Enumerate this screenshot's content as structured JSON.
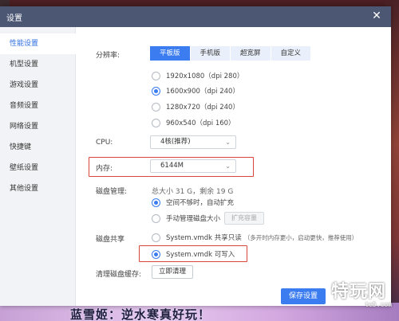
{
  "window": {
    "title": "设置"
  },
  "sidebar": {
    "items": [
      {
        "label": "性能设置"
      },
      {
        "label": "机型设置"
      },
      {
        "label": "游戏设置"
      },
      {
        "label": "音频设置"
      },
      {
        "label": "网络设置"
      },
      {
        "label": "快捷键"
      },
      {
        "label": "壁纸设置"
      },
      {
        "label": "其他设置"
      }
    ]
  },
  "resolution": {
    "label": "分辨率:",
    "tabs": [
      "平板版",
      "手机版",
      "超宽屏",
      "自定义"
    ],
    "options": [
      {
        "label": "1920x1080（dpi 280）",
        "checked": false
      },
      {
        "label": "1600x900（dpi 240）",
        "checked": true
      },
      {
        "label": "1280x720（dpi 240）",
        "checked": false
      },
      {
        "label": "960x540（dpi 160）",
        "checked": false
      }
    ]
  },
  "cpu": {
    "label": "CPU:",
    "value": "4核(推荐)"
  },
  "memory": {
    "label": "内存:",
    "value": "6144M"
  },
  "disk": {
    "label": "磁盘管理:",
    "summary": "总大小 31 G，剩余 19 G",
    "options": [
      {
        "label": "空间不够时，自动扩充",
        "checked": true
      },
      {
        "label": "手动管理磁盘大小",
        "checked": false
      }
    ],
    "expand_button": "扩充容量"
  },
  "disk_share": {
    "label": "磁盘共享",
    "options": [
      {
        "label": "System.vmdk 共享只读",
        "note": "（多开时内存更小，启动更快，推荐使用）",
        "checked": false
      },
      {
        "label": "System.vmdk 可写入",
        "checked": true
      }
    ]
  },
  "cache": {
    "label": "清理磁盘缓存:",
    "button": "立即清理"
  },
  "save_button": "保存设置",
  "background": {
    "bottom_text": "蓝雪姬：逆水寒真好玩！"
  },
  "watermark": {
    "main": "特玩网",
    "sub": "te5.com"
  },
  "colors": {
    "accent": "#3b7cf0",
    "titlebar": "#4b5773",
    "highlight": "#d9453a"
  }
}
